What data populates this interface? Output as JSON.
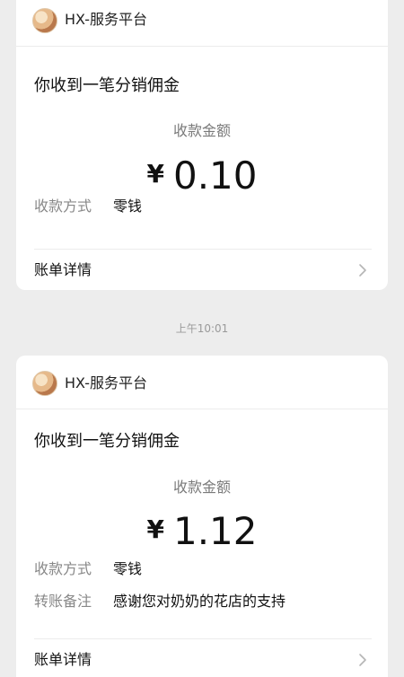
{
  "messages": [
    {
      "app_name": "HX-服务平台",
      "title": "你收到一笔分销佣金",
      "amount_label": "收款金额",
      "currency": "¥",
      "amount": "0.10",
      "rows": [
        {
          "key": "收款方式",
          "value": "零钱"
        }
      ],
      "details_label": "账单详情"
    },
    {
      "app_name": "HX-服务平台",
      "title": "你收到一笔分销佣金",
      "amount_label": "收款金额",
      "currency": "¥",
      "amount": "1.12",
      "rows": [
        {
          "key": "收款方式",
          "value": "零钱"
        },
        {
          "key": "转账备注",
          "value": "感谢您对奶奶的花店的支持"
        }
      ],
      "details_label": "账单详情"
    }
  ],
  "timestamp": "上午10:01",
  "icons": {
    "avatar": "app-avatar-icon",
    "chevron": "chevron-right-icon"
  },
  "colors": {
    "background": "#ededed",
    "card": "#ffffff",
    "secondary_text": "#888888"
  }
}
